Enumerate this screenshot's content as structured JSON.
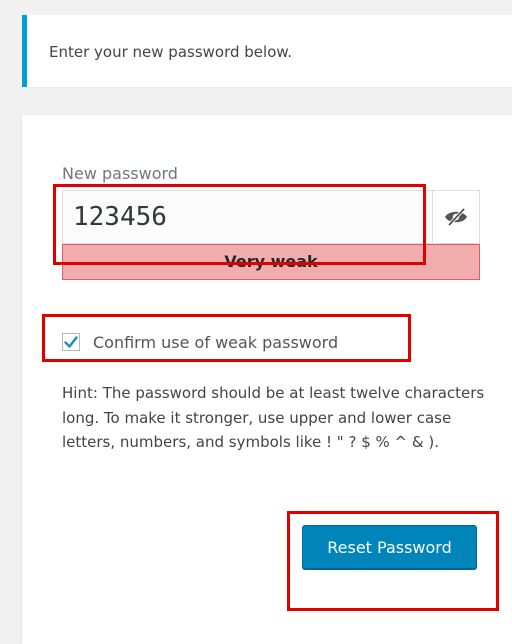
{
  "notice": {
    "message": "Enter your new password below."
  },
  "form": {
    "password_label": "New password",
    "password_value": "123456",
    "strength_text": "Very weak",
    "confirm_weak_label": "Confirm use of weak password",
    "confirm_weak_checked": true,
    "hint": "Hint: The password should be at least twelve characters long. To make it stronger, use upper and lower case letters, numbers, and symbols like ! \" ? $ % ^ & ).",
    "submit_label": "Reset Password"
  },
  "icons": {
    "visibility_toggle": "eye-slash-icon",
    "checkbox": "checkmark-icon"
  },
  "colors": {
    "accent": "#00a0d2",
    "button": "#0085ba",
    "strength_bg": "#f1adad",
    "strength_border": "#e35b5b",
    "highlight": "#e00000"
  }
}
